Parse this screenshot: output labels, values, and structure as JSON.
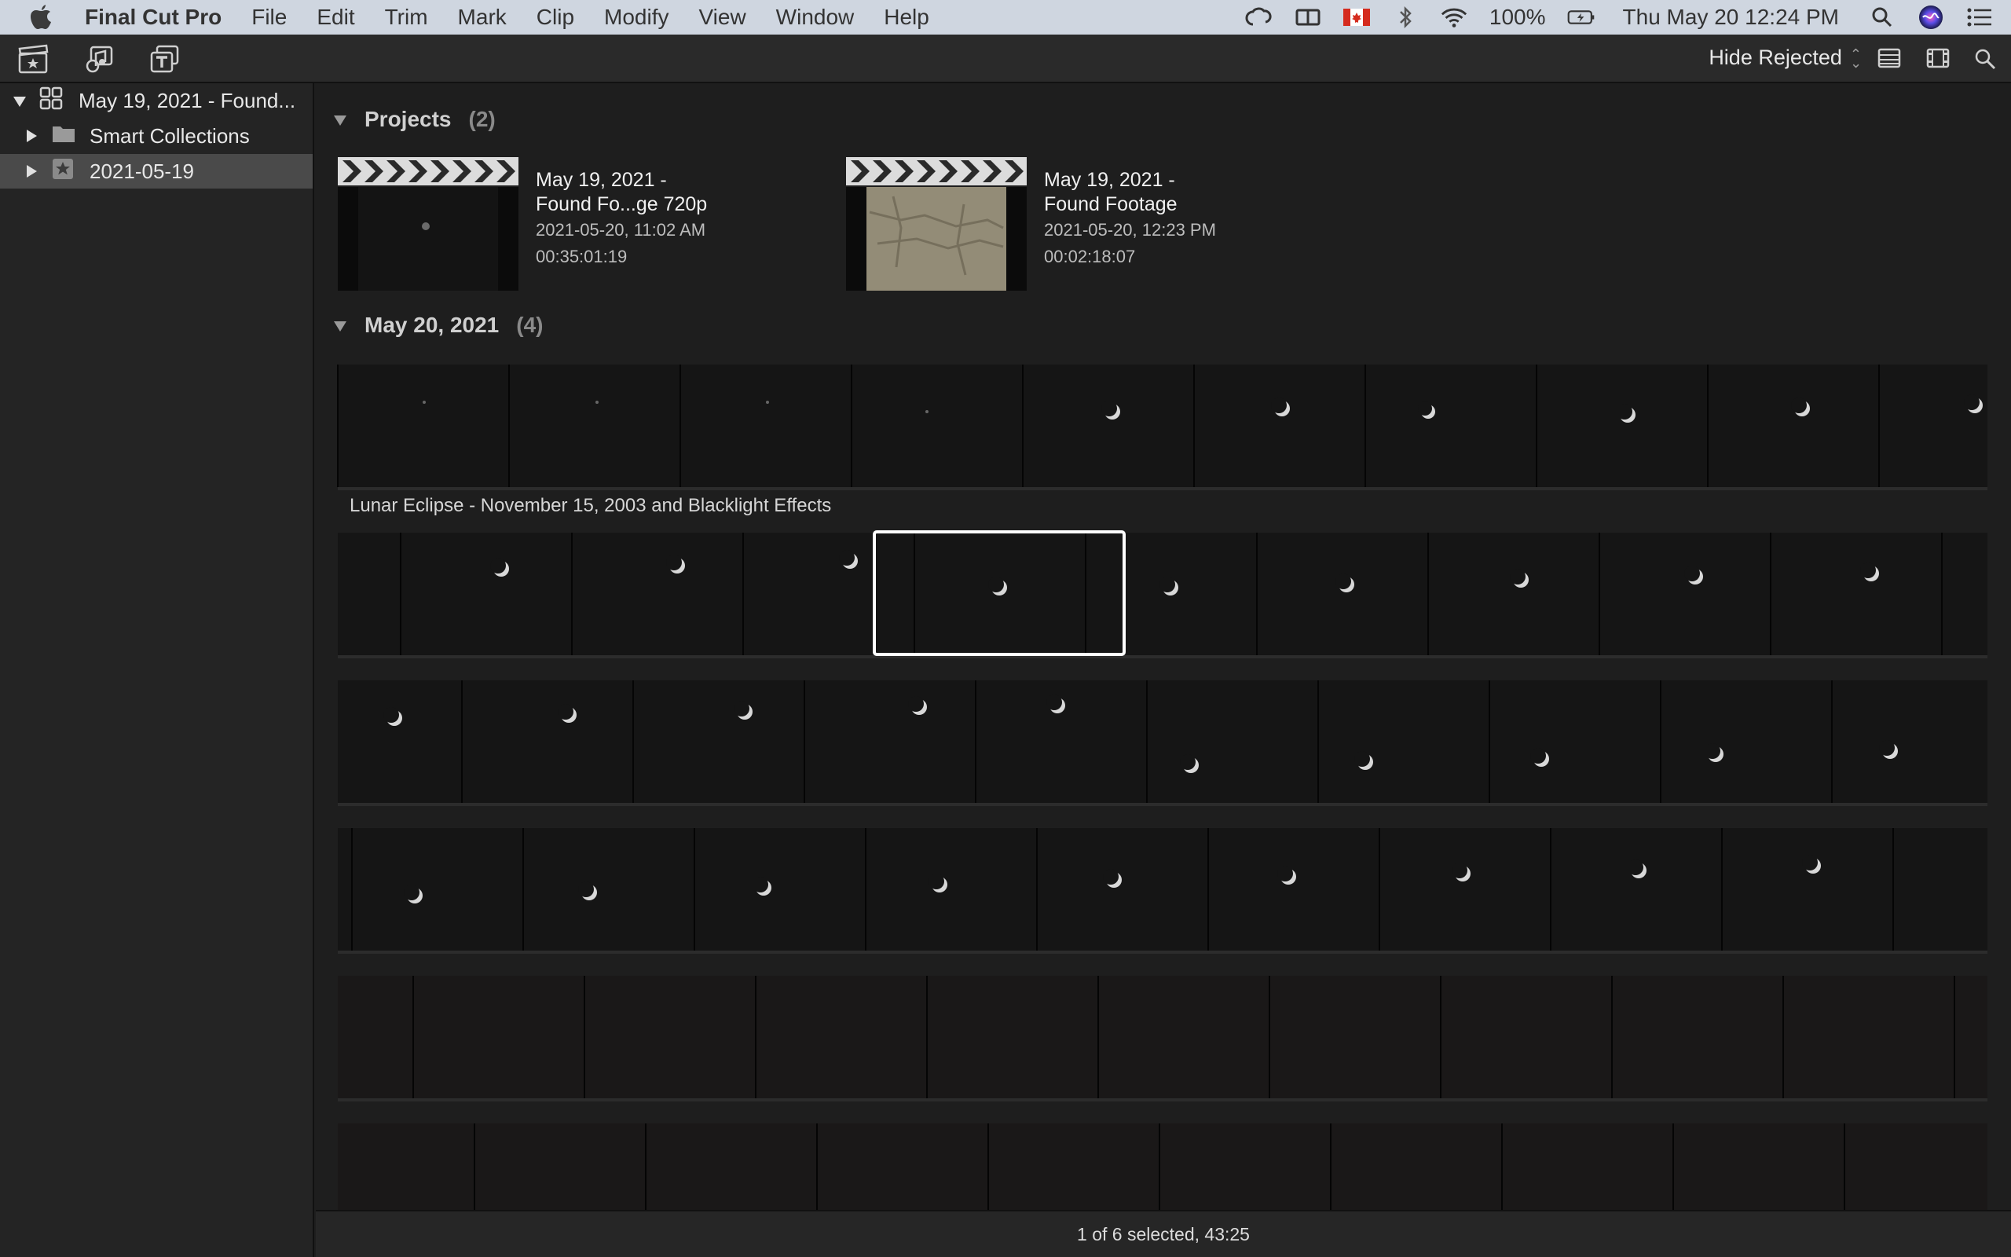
{
  "menubar": {
    "app_name": "Final Cut Pro",
    "items": [
      "File",
      "Edit",
      "Trim",
      "Mark",
      "Clip",
      "Modify",
      "View",
      "Window",
      "Help"
    ],
    "battery": "100%",
    "clock": "Thu May 20  12:24 PM"
  },
  "toolbar": {
    "filter_label": "Hide Rejected"
  },
  "sidebar": {
    "library_name": "May 19, 2021 - Found...",
    "items": [
      {
        "label": "Smart Collections",
        "icon": "folder-icon"
      },
      {
        "label": "2021-05-19",
        "icon": "event-star-icon",
        "selected": true
      }
    ]
  },
  "browser": {
    "projects": {
      "label": "Projects",
      "count": "(2)",
      "items": [
        {
          "title_line1": "May 19, 2021 -",
          "title_line2": "Found Fo...ge 720p",
          "date": "2021-05-20, 11:02 AM",
          "duration": "00:35:01:19"
        },
        {
          "title_line1": "May 19, 2021 -",
          "title_line2": "Found Footage",
          "date": "2021-05-20, 12:23 PM",
          "duration": "00:02:18:07"
        }
      ]
    },
    "event_group": {
      "label": "May 20, 2021",
      "count": "(4)"
    },
    "clip_name": "Lunar Eclipse - November 15, 2003 and Blacklight Effects"
  },
  "status": {
    "selection_text": "1 of 6 selected, 43:25"
  },
  "colors": {
    "menubar_bg": "#cfd6e0",
    "selection_border": "#ffffff",
    "sidebar_selected": "#4a4a4a"
  }
}
